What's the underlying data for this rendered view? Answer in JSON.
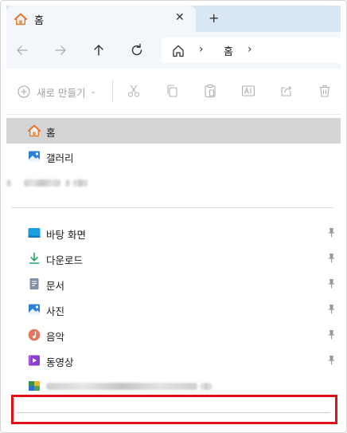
{
  "window": {
    "tab_title": "홈",
    "tab_close": "✕",
    "new_tab": "+"
  },
  "address_bar": {
    "separator_1": "›",
    "location": "홈",
    "separator_2": "›"
  },
  "toolbar": {
    "new_label": "새로 만들기",
    "new_chevron": "⌄",
    "icons": [
      "cut-icon",
      "copy-icon",
      "paste-icon",
      "rename-icon",
      "share-icon",
      "delete-icon"
    ]
  },
  "nav_pane": {
    "top_items": [
      {
        "label": "홈",
        "icon": "home-icon",
        "selected": true
      },
      {
        "label": "갤러리",
        "icon": "gallery-icon",
        "selected": false
      }
    ],
    "quick_access": [
      {
        "label": "바탕 화면",
        "icon": "desktop-icon",
        "pinned": true
      },
      {
        "label": "다운로드",
        "icon": "download-icon",
        "pinned": true
      },
      {
        "label": "문서",
        "icon": "documents-icon",
        "pinned": true
      },
      {
        "label": "사진",
        "icon": "pictures-icon",
        "pinned": true
      },
      {
        "label": "음악",
        "icon": "music-icon",
        "pinned": true
      },
      {
        "label": "동영상",
        "icon": "videos-icon",
        "pinned": true
      }
    ]
  },
  "colors": {
    "tabstrip": "#d9e6f3",
    "navbar": "#f3f6fb",
    "selection": "#d4d4d4",
    "highlight_box": "#e0101a",
    "home_orange": "#e8762b",
    "folder_blue": "#2b7fd8"
  }
}
